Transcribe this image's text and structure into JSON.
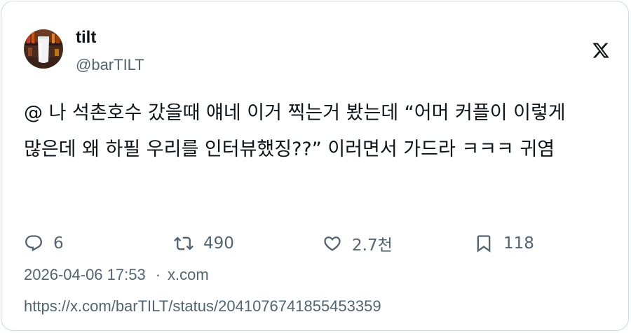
{
  "author": {
    "name": "tilt",
    "handle": "@barTILT"
  },
  "tweet": {
    "text": "@ 나 석촌호수 갔을때 얘네 이거 찍는거 봤는데 “어머 커플이 이렇게 많은데 왜 하필 우리를 인터뷰했징??” 이러면서 가드라 ㅋㅋㅋ 귀염"
  },
  "actions": {
    "reply": {
      "icon": "reply-icon",
      "count": "6"
    },
    "retweet": {
      "icon": "retweet-icon",
      "count": "490"
    },
    "like": {
      "icon": "heart-icon",
      "count": "2.7천"
    },
    "bookmark": {
      "icon": "bookmark-icon",
      "count": "118"
    }
  },
  "meta": {
    "timestamp": "2026-04-06 17:53",
    "separator": "·",
    "source": "x.com",
    "url": "https://x.com/barTILT/status/2041076741855453359"
  },
  "colors": {
    "text": "#0f1419",
    "secondary": "#536471",
    "border": "#cfd9de"
  }
}
